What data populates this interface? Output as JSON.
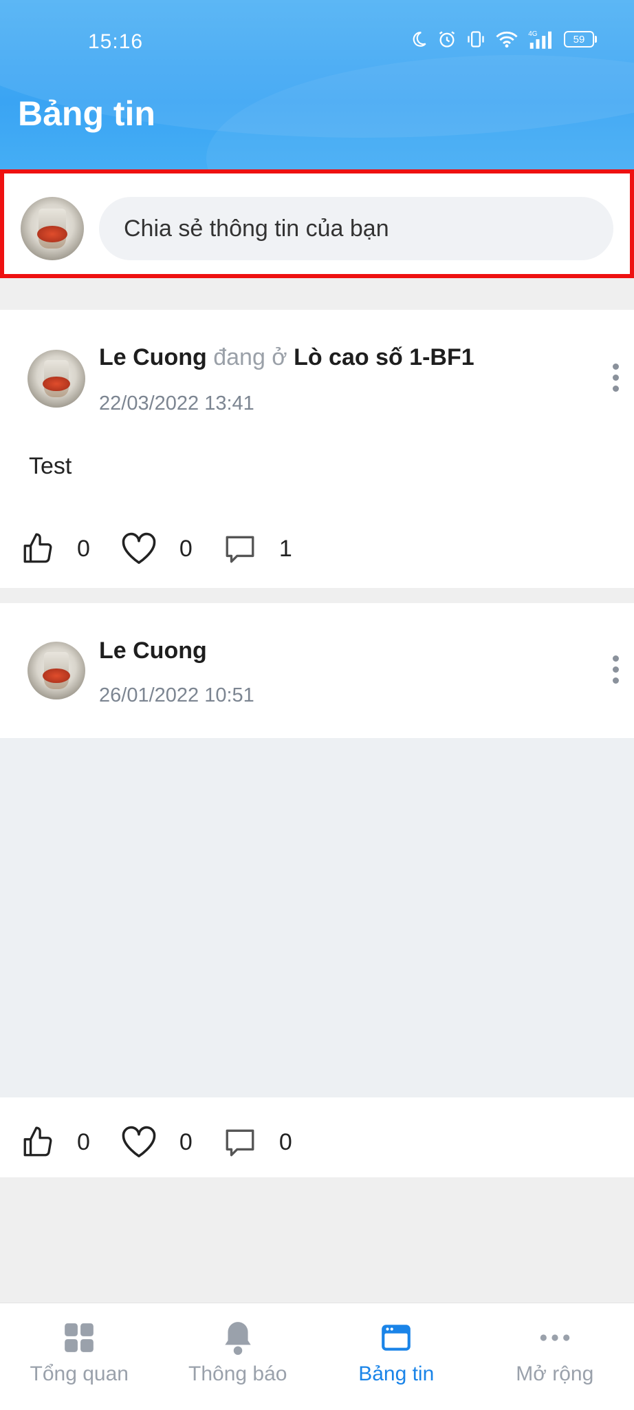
{
  "status_bar": {
    "time": "15:16",
    "battery": "59"
  },
  "header": {
    "title": "Bảng tin"
  },
  "composer": {
    "placeholder": "Chia sẻ thông tin của bạn"
  },
  "posts": [
    {
      "author": "Le Cuong",
      "location_prefix": "đang ở",
      "location": "Lò cao số 1-BF1",
      "time": "22/03/2022 13:41",
      "text": "Test",
      "likes": "0",
      "hearts": "0",
      "comments": "1"
    },
    {
      "author": "Le Cuong",
      "time": "26/01/2022 10:51",
      "likes": "0",
      "hearts": "0",
      "comments": "0"
    }
  ],
  "nav": {
    "items": [
      {
        "label": "Tổng quan",
        "icon": "grid-icon"
      },
      {
        "label": "Thông báo",
        "icon": "bell-icon"
      },
      {
        "label": "Bảng tin",
        "icon": "newsfeed-icon"
      },
      {
        "label": "Mở rộng",
        "icon": "more-horizontal-icon"
      }
    ],
    "active_index": 2,
    "active_color": "#1a84e8",
    "inactive_color": "#9aa1ab"
  },
  "colors": {
    "header": "#3aa4f3",
    "highlight_border": "#ee1111"
  }
}
